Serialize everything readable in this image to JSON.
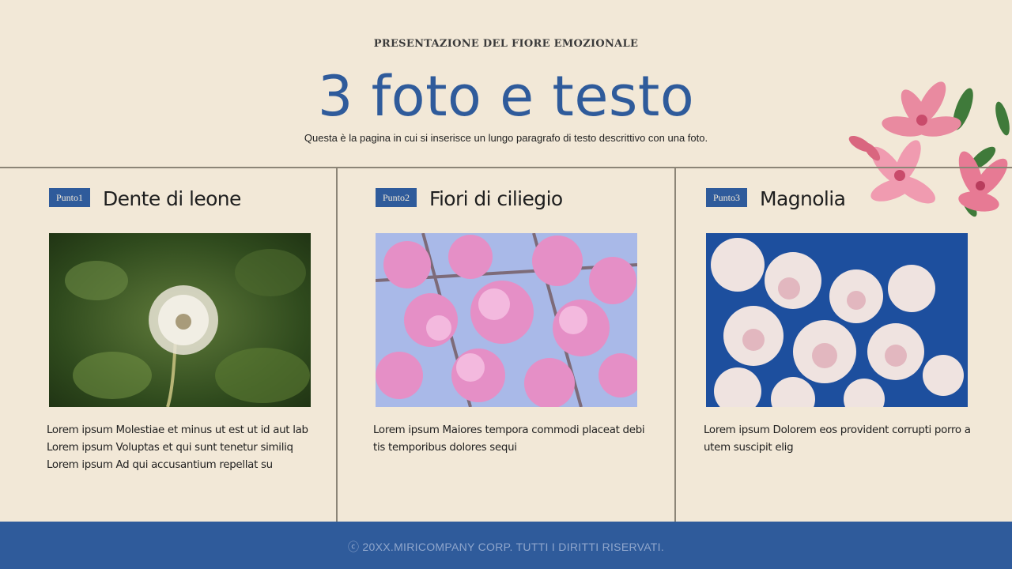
{
  "header": {
    "eyebrow": "PRESENTAZIONE DEL FIORE EMOZIONALE",
    "title": "3 foto e testo",
    "subtitle": "Questa è la pagina in cui si inserisce un lungo paragrafo di testo descrittivo con una foto."
  },
  "columns": [
    {
      "badge": "Punto1",
      "title": "Dente di leone",
      "image": "dandelion-photo",
      "text": "Lorem ipsum Molestiae et minus ut est ut id aut lab Lorem ipsum Voluptas et qui sunt tenetur similiq Lorem ipsum Ad qui accusantium repellat su"
    },
    {
      "badge": "Punto2",
      "title": "Fiori di ciliegio",
      "image": "cherry-blossom-photo",
      "text": "Lorem ipsum Maiores tempora commodi placeat debi tis temporibus dolores sequi"
    },
    {
      "badge": "Punto3",
      "title": "Magnolia",
      "image": "magnolia-photo",
      "text": "Lorem ipsum Dolorem eos provident corrupti porro a utem suscipit elig"
    }
  ],
  "decoration": {
    "corner": "pink-flower-illustration"
  },
  "footer": {
    "copyright": "ⓒ 20XX.MIRICOMPANY CORP. TUTTI I DIRITTI RISERVATI."
  },
  "colors": {
    "background": "#f2e8d7",
    "accent": "#2f5b9b",
    "divider": "#8c8577"
  }
}
